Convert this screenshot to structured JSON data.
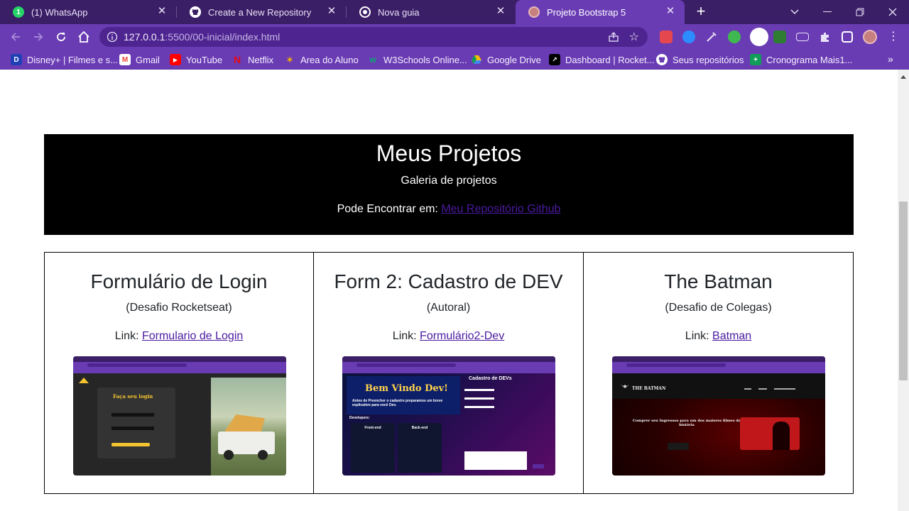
{
  "browser": {
    "tabs": [
      {
        "label": "(1) WhatsApp",
        "icon": "whatsapp-icon",
        "badge": "1",
        "color": "#25d366"
      },
      {
        "label": "Create a New Repository",
        "icon": "github-icon",
        "color": "#ffffff"
      },
      {
        "label": "Nova guia",
        "icon": "chrome-icon",
        "color": "#ffffff"
      },
      {
        "label": "Projeto Bootstrap 5",
        "icon": "avatar-icon",
        "color": "#c77f7f"
      }
    ],
    "url_host": "127.0.0.1",
    "url_rest": ":5500/00-inicial/index.html"
  },
  "bookmarks": [
    {
      "label": "Disney+ | Filmes e s...",
      "icon": "disney-icon",
      "color": "#1f3fb5"
    },
    {
      "label": "Gmail",
      "icon": "gmail-icon",
      "color": "#ea4335"
    },
    {
      "label": "YouTube",
      "icon": "youtube-icon",
      "color": "#ff0000"
    },
    {
      "label": "Netflix",
      "icon": "netflix-icon",
      "color": "#e50914"
    },
    {
      "label": "Area do Aluno",
      "icon": "star-icon",
      "color": "#f4b400"
    },
    {
      "label": "W3Schools Online...",
      "icon": "w3schools-icon",
      "color": "#04aa6d"
    },
    {
      "label": "Google Drive",
      "icon": "drive-icon",
      "color": "#fbbc04"
    },
    {
      "label": "Dashboard | Rocket...",
      "icon": "rocketseat-icon",
      "color": "#000000"
    },
    {
      "label": "Seus repositórios",
      "icon": "github-icon",
      "color": "#ffffff"
    },
    {
      "label": "Cronograma Mais1...",
      "icon": "sheets-icon",
      "color": "#0f9d58"
    }
  ],
  "hero": {
    "title": "Meus Projetos",
    "subtitle": "Galeria de projetos",
    "find_text": "Pode Encontrar em: ",
    "find_link": "Meu Repositório Github"
  },
  "projects": [
    {
      "title": "Formulário de Login",
      "origin": "(Desafio Rocketseat)",
      "link_prefix": "Link: ",
      "link_label": "Formulario de Login"
    },
    {
      "title": "Form 2: Cadastro de DEV",
      "origin": "(Autoral)",
      "link_prefix": "Link: ",
      "link_label": "Formulário2-Dev"
    },
    {
      "title": "The Batman",
      "origin": "(Desafio de Colegas)",
      "link_prefix": "Link: ",
      "link_label": "Batman"
    }
  ],
  "thumbnails": {
    "login": {
      "heading": "Faça seu login"
    },
    "dev": {
      "welcome": "Bem Vindo Dev!",
      "form_title": "Cadastro de DEVs",
      "intro": "Antes de Preencher o cadastro preparamos um breve explicativo para você Dev.",
      "developers": "Developers:",
      "front": "Front-end",
      "back": "Back-end"
    },
    "batman": {
      "brand": "THE BATMAN",
      "headline": "Comprer seu Ingressos para um dos maiores filmes da história"
    }
  },
  "colors": {
    "tab_bar": "#3a1e66",
    "toolbar": "#6a3cb4",
    "hero_bg": "#000000",
    "link": "#4a1aa0"
  }
}
